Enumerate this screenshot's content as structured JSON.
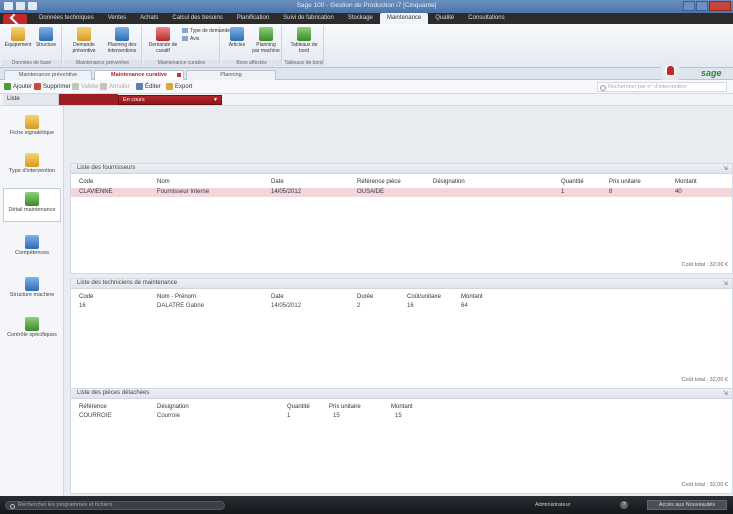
{
  "titlebar": {
    "title": "Sage 100 - Gestion de Production i7 [Cinquante]"
  },
  "ribbon_tabs": [
    "Données techniques",
    "Ventes",
    "Achats",
    "Calcul des besoins",
    "Planification",
    "Suivi de fabrication",
    "Stockage",
    "Maintenance",
    "Qualité",
    "Consultations"
  ],
  "ribbon_active_tab": "Maintenance",
  "ribbon": {
    "groups": [
      {
        "label": "Données de base",
        "buttons": [
          {
            "label": "Équipement",
            "icon": "equipment-icon"
          },
          {
            "label": "Structure",
            "icon": "structure-icon"
          }
        ]
      },
      {
        "label": "Maintenance préventive",
        "buttons": [
          {
            "label": "Demande préventive",
            "icon": "preventive-request-icon"
          },
          {
            "label": "Planning des interventions",
            "icon": "intervention-plan-icon"
          }
        ]
      },
      {
        "label": "Maintenance curative",
        "buttons": [
          {
            "label": "Demande de curatif",
            "icon": "curative-request-icon"
          }
        ],
        "small": [
          {
            "label": "Type de demande",
            "icon": "request-type-icon"
          },
          {
            "label": "Avis",
            "icon": "notice-icon"
          }
        ]
      },
      {
        "label": "Bons affectés",
        "buttons": [
          {
            "label": "Articles",
            "icon": "articles-icon"
          },
          {
            "label": "Planning par machine",
            "icon": "machine-plan-icon"
          }
        ]
      },
      {
        "label": "Tableaux de bord",
        "buttons": [
          {
            "label": "Tableaux de bord",
            "icon": "dashboard-icon"
          }
        ]
      }
    ]
  },
  "doc_tabs": [
    "Maintenance préventive",
    "Maintenance curative",
    "Planning"
  ],
  "doc_active_tab": "Maintenance curative",
  "toolbar": {
    "add": "Ajouter",
    "delete": "Supprimer",
    "validate": "Valider",
    "cancel": "Annuler",
    "print": "Éditer",
    "export": "Export",
    "search_placeholder": "Rechercher par n° d'intervention"
  },
  "filter": {
    "label": "Liste",
    "selected": "En cours"
  },
  "leftnav": [
    {
      "label": "Fiche signalétique",
      "icon": "id-card-icon",
      "color": "yel"
    },
    {
      "label": "Type d'intervention",
      "icon": "intervention-type-icon",
      "color": "yel"
    },
    {
      "label": "Détail maintenance",
      "icon": "maintenance-detail-icon",
      "color": "grn"
    },
    {
      "label": "Compétences",
      "icon": "skills-icon",
      "color": "blu"
    },
    {
      "label": "Structure machine",
      "icon": "machine-structure-icon",
      "color": "blu"
    },
    {
      "label": "Contrôle spécifiques",
      "icon": "checks-icon",
      "color": "grn"
    }
  ],
  "leftnav_active": 2,
  "sections": [
    {
      "title": "Liste des fournisseurs",
      "headers": [
        "Code",
        "Nom",
        "Date",
        "Référence pièce",
        "Désignation",
        "Quantité",
        "Prix unitaire",
        "Montant"
      ],
      "rows": [
        [
          "CLAVIENNE",
          "Fournisseur Interne",
          "14/05/2012",
          "OUSAIDE",
          "",
          "1",
          "8",
          "40"
        ]
      ],
      "total": "Coût total : 32,00 €"
    },
    {
      "title": "Liste des techniciens de maintenance",
      "headers": [
        "Code",
        "Nom - Prénom",
        "Date",
        "Durée",
        "Coût/unitaire",
        "Montant"
      ],
      "rows": [
        [
          "16",
          "DALATRE Gabrie",
          "14/05/2012",
          "2",
          "16",
          "64"
        ]
      ],
      "total": "Coût total : 32,00 €"
    },
    {
      "title": "Liste des pièces détachées",
      "headers": [
        "Référence",
        "Désignation",
        "Quantité",
        "Prix unitaire",
        "Montant"
      ],
      "rows": [
        [
          "COURROIE",
          "Courroie",
          "1",
          "15",
          "15"
        ]
      ],
      "total": "Coût total : 32,00 €"
    }
  ],
  "statusbar": {
    "search_placeholder": "Rechercher les programmes et fichiers",
    "user": "Administrateur",
    "help": "?",
    "button": "Accès aux Nouveautés"
  },
  "colors": {
    "accent": "#b0252b",
    "selected_row": "#f3d6da",
    "statusbar": "#1f2227"
  }
}
